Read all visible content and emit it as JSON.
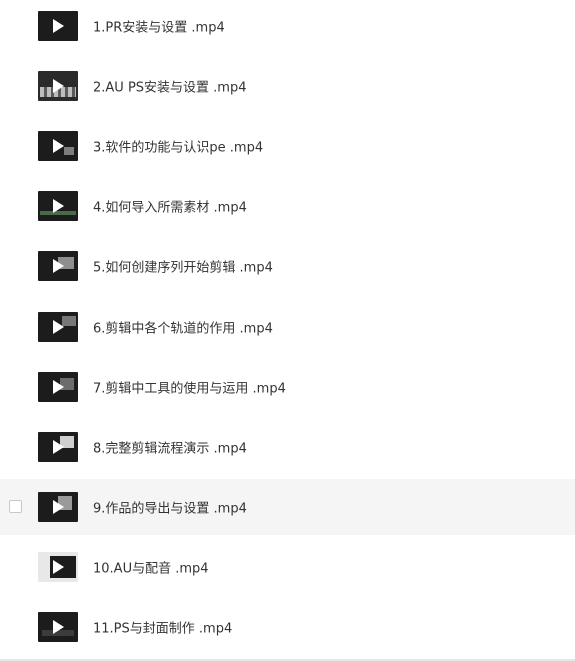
{
  "files": [
    {
      "name": "1.PR安装与设置 .mp4",
      "icon": "video-thumbnail-icon"
    },
    {
      "name": "2.AU PS安装与设置 .mp4",
      "icon": "video-thumbnail-icon"
    },
    {
      "name": "3.软件的功能与认识pe .mp4",
      "icon": "video-thumbnail-icon"
    },
    {
      "name": "4.如何导入所需素材 .mp4",
      "icon": "video-thumbnail-icon"
    },
    {
      "name": "5.如何创建序列开始剪辑 .mp4",
      "icon": "video-thumbnail-icon"
    },
    {
      "name": "6.剪辑中各个轨道的作用 .mp4",
      "icon": "video-thumbnail-icon"
    },
    {
      "name": "7.剪辑中工具的使用与运用 .mp4",
      "icon": "video-thumbnail-icon"
    },
    {
      "name": "8.完整剪辑流程演示 .mp4",
      "icon": "video-thumbnail-icon"
    },
    {
      "name": "9.作品的导出与设置 .mp4",
      "icon": "video-thumbnail-icon",
      "hovered": true
    },
    {
      "name": "10.AU与配音 .mp4",
      "icon": "video-thumbnail-icon"
    },
    {
      "name": "11.PS与封面制作 .mp4",
      "icon": "video-thumbnail-icon"
    }
  ],
  "colors": {
    "text": "#333333",
    "hover_bg": "#f5f5f5",
    "thumb_bg": "#1c1c1c"
  }
}
